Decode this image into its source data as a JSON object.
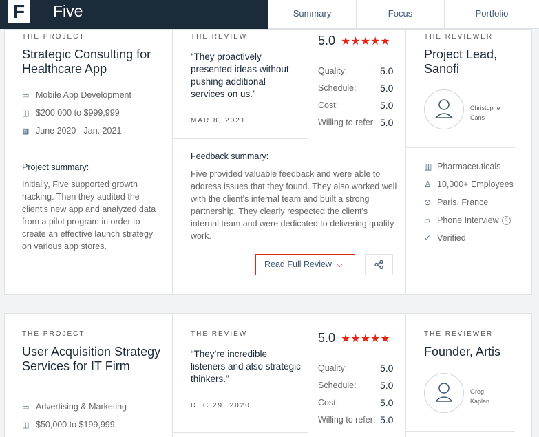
{
  "brand": {
    "logo": "F",
    "name": "Five"
  },
  "tabs": [
    {
      "label": "Summary"
    },
    {
      "label": "Focus"
    },
    {
      "label": "Portfolio"
    }
  ],
  "reviews": [
    {
      "project_caption": "THE PROJECT",
      "project_title": "Strategic Consulting for Healthcare App",
      "service": "Mobile App Development",
      "budget": "$200,000 to $999,999",
      "dates": "June 2020 - Jan. 2021",
      "summary_label": "Project summary:",
      "summary": "Initially, Five supported growth hacking. Then they audited the client's new app and analyzed data from a pilot program in order to create an effective launch strategy on various app stores.",
      "review_caption": "THE REVIEW",
      "overall": "5.0",
      "stars": "★★★★★",
      "quote": "“They proactively presented ideas without pushing additional services on us.”",
      "date": "MAR 8, 2021",
      "ratings": [
        {
          "label": "Quality:",
          "value": "5.0"
        },
        {
          "label": "Schedule:",
          "value": "5.0"
        },
        {
          "label": "Cost:",
          "value": "5.0"
        },
        {
          "label": "Willing to refer:",
          "value": "5.0"
        }
      ],
      "feedback_label": "Feedback summary:",
      "feedback": "Five provided valuable feedback and were able to address issues that they found. They also worked well with the client's internal team and built a strong partnership. They clearly respected the client's internal team and were dedicated to delivering quality work.",
      "read_button": "Read Full Review",
      "reviewer_caption": "THE REVIEWER",
      "reviewer_title": "Project Lead, Sanofi",
      "reviewer_name_1": "Christophe",
      "reviewer_name_2": "Cans",
      "industry": "Pharmaceuticals",
      "employees": "10,000+ Employees",
      "location": "Paris, France",
      "interview": "Phone Interview",
      "verified": "Verified"
    },
    {
      "project_caption": "THE PROJECT",
      "project_title": "User Acquisition Strategy Services for IT Firm",
      "service": "Advertising & Marketing",
      "budget": "$50,000 to $199,999",
      "review_caption": "THE REVIEW",
      "overall": "5.0",
      "stars": "★★★★★",
      "quote": "“They’re incredible listeners and also strategic thinkers.”",
      "date": "DEC 29, 2020",
      "ratings": [
        {
          "label": "Quality:",
          "value": "5.0"
        },
        {
          "label": "Schedule:",
          "value": "5.0"
        },
        {
          "label": "Cost:",
          "value": "5.0"
        },
        {
          "label": "Willing to refer:",
          "value": "5.0"
        }
      ],
      "reviewer_caption": "THE REVIEWER",
      "reviewer_title": "Founder, Artis",
      "reviewer_name_1": "Greg",
      "reviewer_name_2": "Kaplan"
    }
  ],
  "colors": {
    "brand_dark": "#1c2b39",
    "accent_red": "#e62415",
    "link_blue": "#3f5875"
  },
  "icons": [
    "monitor-icon",
    "price-tag-icon",
    "calendar-icon",
    "building-icon",
    "person-icon",
    "location-pin-icon",
    "chat-bubble-icon",
    "check-circle-icon",
    "help-icon",
    "share-icon",
    "chevron-down-icon"
  ]
}
